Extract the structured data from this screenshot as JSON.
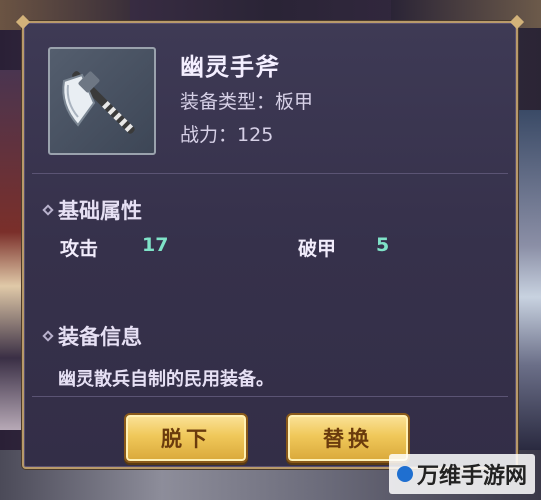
{
  "item": {
    "name": "幽灵手斧",
    "type_label": "装备类型：",
    "type_value": "板甲",
    "power_label": "战力：",
    "power_value": "125",
    "icon": "axe-icon"
  },
  "basic_attributes": {
    "heading": "基础属性",
    "stats": [
      {
        "label": "攻击",
        "value": "17"
      },
      {
        "label": "破甲",
        "value": "5"
      }
    ]
  },
  "equipment_info": {
    "heading": "装备信息",
    "description": "幽灵散兵自制的民用装备。"
  },
  "buttons": {
    "unequip": "脱下",
    "replace": "替换"
  },
  "watermark": {
    "text": "万维手游网"
  },
  "colors": {
    "stat_value": "#7fe3c8",
    "button_fill": "#f0c85a",
    "panel_border": "#b89a6a"
  }
}
